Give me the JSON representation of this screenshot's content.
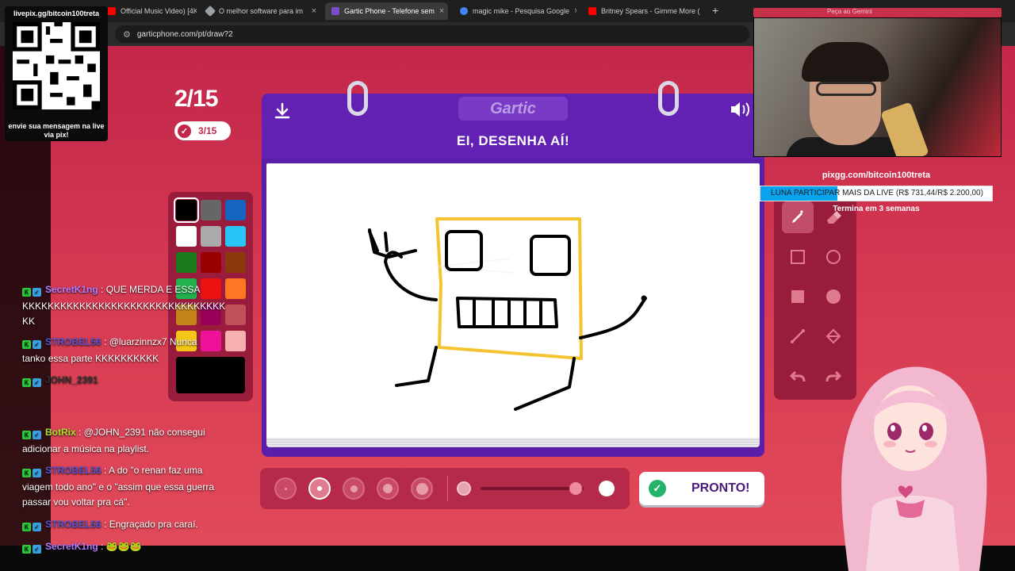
{
  "browser": {
    "tabs": [
      {
        "label": "Official Music Video) [4K",
        "color": "#ff0000",
        "muted": false
      },
      {
        "label": "O melhor software para im",
        "color": "#9aa0a6",
        "muted": true
      },
      {
        "label": "Gartic Phone - Telefone sem",
        "color": "#7a4cc9",
        "muted": true,
        "active": true
      },
      {
        "label": "magic mike - Pesquisa Google",
        "color": "#4285f4",
        "muted": false
      },
      {
        "label": "Britney Spears - Gimme More (",
        "color": "#ff0000",
        "muted": false
      }
    ],
    "new_tab": "+",
    "url": "garticphone.com/pt/draw?2"
  },
  "round": {
    "current": "2/15",
    "done": "3/15"
  },
  "palette": {
    "colors": [
      "#000000",
      "#666666",
      "#1565c0",
      "#ffffff",
      "#aaaaaa",
      "#29c5f6",
      "#1b7a1b",
      "#990000",
      "#8b3a0e",
      "#22b14c",
      "#ee1111",
      "#ff7722",
      "#c4861a",
      "#99005a",
      "#c0505a",
      "#f5c518",
      "#ee1199",
      "#f7b0b0"
    ],
    "selected_index": 0,
    "current_color": "#000000"
  },
  "card": {
    "logo": "Gartic",
    "title": "EI, DESENHA AÍ!"
  },
  "tools": {
    "items": [
      "pencil-icon",
      "eraser-icon",
      "rectangle-outline-icon",
      "ellipse-outline-icon",
      "rectangle-fill-icon",
      "ellipse-fill-icon",
      "line-icon",
      "bucket-icon",
      "undo-icon",
      "redo-icon"
    ],
    "selected_index": 0
  },
  "brush": {
    "sizes": 5,
    "selected_index": 1,
    "opacity_level": 0.92
  },
  "ready_button": "PRONTO!",
  "overlay": {
    "qr_top": "livepix.gg/bitcoin100treta",
    "qr_bottom": "envie sua mensagem na live via pix!",
    "donate_url": "pixgg.com/bitcoin100treta",
    "donate_goal_label": "LUNA PARTICIPAR MAIS DA LIVE (R$ 731,44/R$ 2.200,00)",
    "donate_progress": 0.3325,
    "donate_end": "Termina em 3 semanas",
    "cam_header": "Peça ao Gemini"
  },
  "chat": [
    {
      "user": "SecretK1ng",
      "user_color": "#b07cff",
      "text": "QUE MERDA E ESSA KKKKKKKKKKKKKKKKKKKKKKKKKKKKKKKK KK"
    },
    {
      "user": "STROBEL56",
      "user_color": "#5555cc",
      "text": "@luarzinnzx7 Nunca tanko essa parte KKKKKKKKKK"
    },
    {
      "user": "JOHN_2391",
      "user_color": "#333333",
      "text": ""
    },
    {
      "user": "BotRix",
      "user_color": "#a6e22e",
      "text": "@JOHN_2391 não consegui adicionar a música na playlist."
    },
    {
      "user": "STROBEL56",
      "user_color": "#5555cc",
      "text": "A do \"o renan faz uma viagem todo ano\" e o \"assim que essa guerra passar vou voltar pra cá\"."
    },
    {
      "user": "STROBEL56",
      "user_color": "#5555cc",
      "text": "Engraçado pra caraí."
    },
    {
      "user": "SecretK1ng",
      "user_color": "#b07cff",
      "text": "🐸🐸🐸"
    }
  ]
}
